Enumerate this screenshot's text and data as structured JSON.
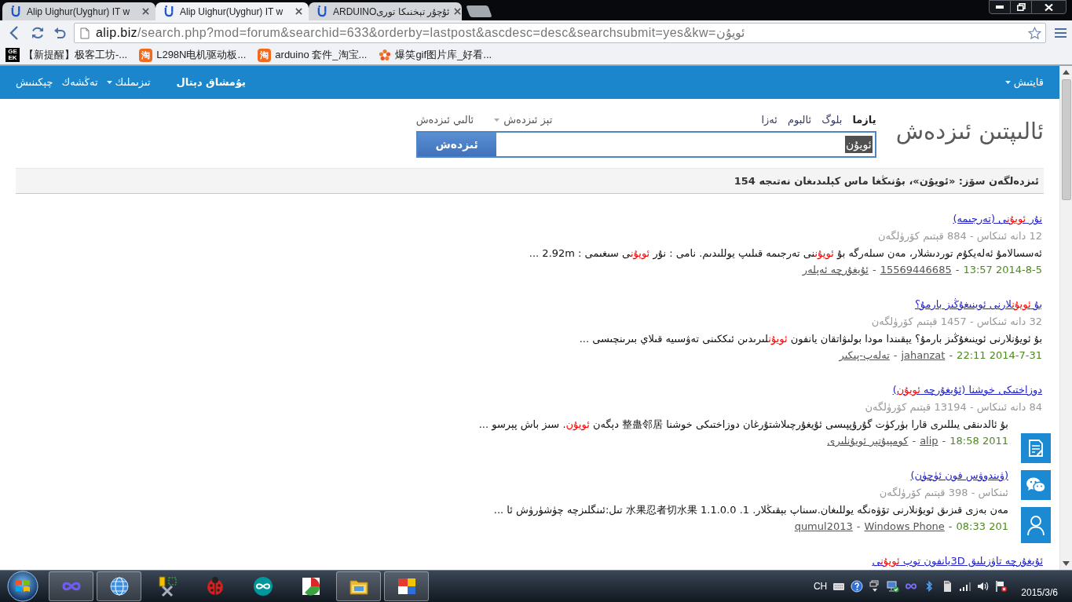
{
  "browser": {
    "tabs": [
      {
        "title": "ARDUINOئۇچۇر تېخنىكا تورى",
        "selected": false
      },
      {
        "title": "Alip Uighur(Uyghur) IT w",
        "selected": true
      },
      {
        "title": "Alip Uighur(Uyghur) IT w",
        "selected": false
      }
    ],
    "address": {
      "host": "alip.biz",
      "path": "/search.php?mod=forum&searchid=633&orderby=lastpost&ascdesc=desc&searchsubmit=yes&kw=ئويۇن"
    },
    "bookmarks": [
      {
        "kind": "flower",
        "title": "爆笑gif图片库_好看..."
      },
      {
        "kind": "orange-badge",
        "badge": [
          "淘"
        ],
        "title": "arduino 套件_淘宝..."
      },
      {
        "kind": "orange-badge",
        "badge": [
          "淘"
        ],
        "title": "L298N电机驱动板..."
      },
      {
        "kind": "dark-badge",
        "badge": [
          "GE",
          "EK"
        ],
        "title": "【新提醒】极客工坊-..."
      }
    ]
  },
  "nav": {
    "right": [
      {
        "label": "قايتىش",
        "dropdown": true,
        "bold": false
      }
    ],
    "left": [
      {
        "label": "يۇمشاق دېتال",
        "dropdown": false,
        "bold": true
      },
      {
        "label": "تىزىملىك",
        "dropdown": true,
        "bold": false
      },
      {
        "label": "تەڭشەك",
        "dropdown": false,
        "bold": false
      },
      {
        "label": "چېكىنىش",
        "dropdown": false,
        "bold": false
      }
    ]
  },
  "search": {
    "logo": "ئالىپتىن ئىزدەش",
    "tabs": [
      {
        "label": "يازما",
        "selected": true
      },
      {
        "label": "بلوگ",
        "selected": false
      },
      {
        "label": "ئالبوم",
        "selected": false
      },
      {
        "label": "ئەزا",
        "selected": false
      }
    ],
    "links": [
      {
        "label": "تېز ئىزدەش",
        "dropdown": true
      },
      {
        "label": "ئالىي ئىزدەش",
        "dropdown": false
      }
    ],
    "value": "ئويۇن",
    "value_selected": true,
    "button": "ئىزدەش"
  },
  "summary": "ئىزدەلگەن سۆز: «ئويۇن»، بۇنىڭغا ماس كېلىدىغان نەتىجە 154",
  "results": [
    {
      "title": [
        {
          "text": "نۇر ",
          "hit": false
        },
        {
          "text": "ئويۇن",
          "hit": true
        },
        {
          "text": "ى (تەرجىمە)",
          "hit": false
        }
      ],
      "stats": "12 دانە ئىنكاس - 884 قېتىم كۆرۈلگەن",
      "snippet": [
        {
          "text": "ئەسسالامۇ ئەلەيكۇم توردىشلار، مەن سىلەرگە بۇ ",
          "hit": false
        },
        {
          "text": "ئويۇن",
          "hit": true
        },
        {
          "text": "نى تەرجىمە قىلىپ يوللىدىم. نامى : نۇر ",
          "hit": false
        },
        {
          "text": "ئويۇن",
          "hit": true
        },
        {
          "text": "ى سىغىمى : 2.92m ...",
          "hit": false
        }
      ],
      "footer": [
        {
          "kind": "date",
          "text": "2014-8-5 13:57"
        },
        {
          "kind": "separator",
          "text": "-"
        },
        {
          "kind": "author",
          "text": "15569446685"
        },
        {
          "kind": "separator",
          "text": "-"
        },
        {
          "kind": "forum",
          "text": "ئۇيغۇرچە ئەپلەر"
        }
      ]
    },
    {
      "title": [
        {
          "text": "بۇ ",
          "hit": false
        },
        {
          "text": "ئويۇن",
          "hit": true
        },
        {
          "text": "لارنى ئوينىغۇڭىز بارمۇ؟",
          "hit": false
        }
      ],
      "stats": "32 دانە ئىنكاس - 1457 قېتىم كۆرۈلگەن",
      "snippet": [
        {
          "text": "بۇ ئويۇنلارنى ئوينىغۇڭىز بارمۇ؟ يېقىندا مودا بولىۋاتقان يانفون ",
          "hit": false
        },
        {
          "text": "ئويۇن",
          "hit": true
        },
        {
          "text": "لىرىدىن ئىككىنى تەۋسىيە قىلاي بىرىنچىسى ...",
          "hit": false
        }
      ],
      "footer": [
        {
          "kind": "date",
          "text": "2014-7-31 22:11"
        },
        {
          "kind": "separator",
          "text": "-"
        },
        {
          "kind": "author",
          "text": "jahanzat"
        },
        {
          "kind": "separator",
          "text": "-"
        },
        {
          "kind": "forum",
          "text": "تەلەپ-پىكىر"
        }
      ]
    },
    {
      "title": [
        {
          "text": "دوزاختىكى خوشنا (ئۇيغۇرچە ",
          "hit": false
        },
        {
          "text": "ئويۇن",
          "hit": true
        },
        {
          "text": ")",
          "hit": false
        }
      ],
      "stats": "84 دانە ئىنكاس - 13194 قېتىم كۆرۈلگەن",
      "snippet": [
        {
          "text": "بۇ ئالدىنقى يىللىرى قارا بۈركۈت گۇرۇپپىسى ئۇيغۇرچىلاشتۇرغان دوزاختىكى خوشنا 整蛊邻居 دېگەن ",
          "hit": false
        },
        {
          "text": "ئويۇن",
          "hit": true
        },
        {
          "text": ". سىز باش پېرسو ...",
          "hit": false
        }
      ],
      "footer": [
        {
          "kind": "date",
          "text": "2011 18:58"
        },
        {
          "kind": "separator",
          "text": "-"
        },
        {
          "kind": "author",
          "text": "alip"
        },
        {
          "kind": "separator",
          "text": "-"
        },
        {
          "kind": "forum",
          "text": "كومپيۇتېر ئويۇنلىرى"
        }
      ]
    },
    {
      "title": [
        {
          "text": "(ۋىندوۋس فون ئۈچۈن)",
          "hit": false
        }
      ],
      "stats": "ئىنكاس - 398 قېتىم كۆرۈلگەن",
      "snippet": [
        {
          "text": "مەن بەزى قىزىق ئويۇنلارنى تۆۋەنگە يوللىغان.سىناپ بېقىڭلار. 1. 1.1.0.0 水果忍者切水果 تىل:ئىنگلىزچە چۈشۈرۈش ئا ...",
          "hit": false
        }
      ],
      "footer": [
        {
          "kind": "date",
          "text": "201 08:33"
        },
        {
          "kind": "separator",
          "text": "-"
        },
        {
          "kind": "forum",
          "text": "Windows Phone"
        },
        {
          "kind": "separator",
          "text": "-"
        },
        {
          "kind": "author",
          "text": "qumul2013"
        }
      ]
    },
    {
      "title": [
        {
          "text": "ئۇيغۇرچە تاۋزىلىق 3Dيانفون توپ ",
          "hit": false
        },
        {
          "text": "ئويۇن",
          "hit": true
        },
        {
          "text": "ى",
          "hit": false
        }
      ]
    }
  ],
  "taskbar": {
    "apps": [
      {
        "running": true
      },
      {
        "running": true
      },
      {
        "running": false
      },
      {
        "running": false
      },
      {
        "running": false
      },
      {
        "running": false
      },
      {
        "running": true
      },
      {
        "running": true
      }
    ],
    "language": "CH",
    "date": "2015/3/6"
  }
}
